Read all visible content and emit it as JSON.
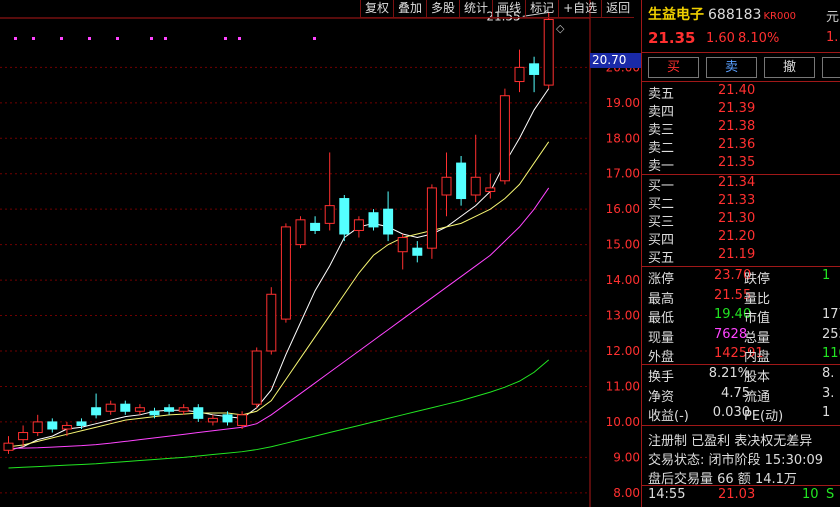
{
  "toolbar": [
    "复权",
    "叠加",
    "多股",
    "统计",
    "画线",
    "标记",
    "+自选",
    "返回"
  ],
  "colors": {
    "up": "#ff3030",
    "down": "#54ffff",
    "ma1": "#ffffff",
    "ma2": "#f6f673",
    "ma3": "#ff44ff",
    "ma4": "#22e622",
    "axis": "#b01818",
    "grid": "#700000",
    "sidebar_label": "#dddddd"
  },
  "chart_data": {
    "type": "candlestick",
    "ylim": [
      7.6,
      21.9
    ],
    "yticks": [
      "8.00",
      "9.00",
      "10.00",
      "11.00",
      "12.00",
      "13.00",
      "14.00",
      "15.00",
      "16.00",
      "17.00",
      "18.00",
      "19.00",
      "20.00"
    ],
    "current_price_label": "20.70",
    "high_annotation": "21.55",
    "candles": [
      {
        "o": 9.2,
        "c": 9.4,
        "h": 9.6,
        "l": 9.1
      },
      {
        "o": 9.5,
        "c": 9.7,
        "h": 9.9,
        "l": 9.3
      },
      {
        "o": 9.7,
        "c": 10.0,
        "h": 10.2,
        "l": 9.6
      },
      {
        "o": 10.0,
        "c": 9.8,
        "h": 10.1,
        "l": 9.7
      },
      {
        "o": 9.8,
        "c": 9.9,
        "h": 10.0,
        "l": 9.6
      },
      {
        "o": 10.0,
        "c": 9.9,
        "h": 10.1,
        "l": 9.8
      },
      {
        "o": 10.4,
        "c": 10.2,
        "h": 10.8,
        "l": 10.1
      },
      {
        "o": 10.3,
        "c": 10.5,
        "h": 10.6,
        "l": 10.2
      },
      {
        "o": 10.5,
        "c": 10.3,
        "h": 10.6,
        "l": 10.2
      },
      {
        "o": 10.3,
        "c": 10.4,
        "h": 10.5,
        "l": 10.2
      },
      {
        "o": 10.3,
        "c": 10.2,
        "h": 10.4,
        "l": 10.1
      },
      {
        "o": 10.4,
        "c": 10.3,
        "h": 10.5,
        "l": 10.2
      },
      {
        "o": 10.3,
        "c": 10.4,
        "h": 10.5,
        "l": 10.2
      },
      {
        "o": 10.4,
        "c": 10.1,
        "h": 10.5,
        "l": 10.0
      },
      {
        "o": 10.0,
        "c": 10.1,
        "h": 10.2,
        "l": 9.9
      },
      {
        "o": 10.2,
        "c": 10.0,
        "h": 10.3,
        "l": 9.9
      },
      {
        "o": 9.9,
        "c": 10.2,
        "h": 10.3,
        "l": 9.8
      },
      {
        "o": 10.5,
        "c": 12.0,
        "h": 12.1,
        "l": 10.4
      },
      {
        "o": 12.0,
        "c": 13.6,
        "h": 13.8,
        "l": 11.9
      },
      {
        "o": 12.9,
        "c": 15.5,
        "h": 15.6,
        "l": 12.8
      },
      {
        "o": 15.0,
        "c": 15.7,
        "h": 15.8,
        "l": 14.9
      },
      {
        "o": 15.6,
        "c": 15.4,
        "h": 15.8,
        "l": 15.3
      },
      {
        "o": 15.6,
        "c": 16.1,
        "h": 17.6,
        "l": 15.4
      },
      {
        "o": 16.3,
        "c": 15.3,
        "h": 16.4,
        "l": 15.1
      },
      {
        "o": 15.4,
        "c": 15.7,
        "h": 15.8,
        "l": 15.2
      },
      {
        "o": 15.9,
        "c": 15.5,
        "h": 16.0,
        "l": 15.4
      },
      {
        "o": 16.0,
        "c": 15.3,
        "h": 16.5,
        "l": 15.1
      },
      {
        "o": 14.8,
        "c": 15.2,
        "h": 15.3,
        "l": 14.3
      },
      {
        "o": 14.9,
        "c": 14.7,
        "h": 15.1,
        "l": 14.5
      },
      {
        "o": 14.9,
        "c": 16.6,
        "h": 16.7,
        "l": 14.6
      },
      {
        "o": 16.4,
        "c": 16.9,
        "h": 17.6,
        "l": 15.8
      },
      {
        "o": 17.3,
        "c": 16.3,
        "h": 17.5,
        "l": 16.1
      },
      {
        "o": 16.4,
        "c": 16.9,
        "h": 18.1,
        "l": 16.2
      },
      {
        "o": 16.5,
        "c": 16.6,
        "h": 17.0,
        "l": 16.3
      },
      {
        "o": 16.8,
        "c": 19.2,
        "h": 19.4,
        "l": 16.7
      },
      {
        "o": 19.6,
        "c": 20.0,
        "h": 20.5,
        "l": 19.3
      },
      {
        "o": 20.1,
        "c": 19.8,
        "h": 20.3,
        "l": 19.3
      },
      {
        "o": 19.5,
        "c": 21.35,
        "h": 21.55,
        "l": 19.4
      }
    ],
    "ma_lines": [
      {
        "name": "MA5",
        "color": "#ffffff",
        "values": [
          9.2,
          9.3,
          9.5,
          9.6,
          9.8,
          9.85,
          9.95,
          10.05,
          10.15,
          10.2,
          10.3,
          10.33,
          10.33,
          10.28,
          10.2,
          10.15,
          10.1,
          10.4,
          10.9,
          11.9,
          12.8,
          13.7,
          14.4,
          15.2,
          15.5,
          15.6,
          15.5,
          15.3,
          15.2,
          15.3,
          15.5,
          15.8,
          16.1,
          16.5,
          17.3,
          18.0,
          18.8,
          19.4
        ]
      },
      {
        "name": "MA10",
        "color": "#f6f673",
        "values": [
          9.3,
          9.35,
          9.45,
          9.55,
          9.65,
          9.75,
          9.85,
          9.95,
          10.05,
          10.1,
          10.15,
          10.2,
          10.22,
          10.25,
          10.25,
          10.25,
          10.2,
          10.3,
          10.6,
          11.2,
          11.8,
          12.4,
          13.0,
          13.6,
          14.2,
          14.7,
          15.0,
          15.2,
          15.3,
          15.4,
          15.5,
          15.6,
          15.8,
          16.0,
          16.3,
          16.7,
          17.3,
          17.9
        ]
      },
      {
        "name": "MA20",
        "color": "#ff44ff",
        "values": [
          9.25,
          9.26,
          9.27,
          9.29,
          9.31,
          9.33,
          9.36,
          9.4,
          9.45,
          9.5,
          9.55,
          9.6,
          9.65,
          9.7,
          9.75,
          9.8,
          9.85,
          9.95,
          10.2,
          10.5,
          10.8,
          11.1,
          11.4,
          11.7,
          12.0,
          12.3,
          12.6,
          12.9,
          13.2,
          13.5,
          13.8,
          14.1,
          14.4,
          14.7,
          15.1,
          15.5,
          16.0,
          16.6
        ]
      },
      {
        "name": "MA60",
        "color": "#22e622",
        "values": [
          8.7,
          8.72,
          8.74,
          8.76,
          8.78,
          8.8,
          8.82,
          8.85,
          8.88,
          8.91,
          8.94,
          8.97,
          9.0,
          9.04,
          9.08,
          9.12,
          9.16,
          9.22,
          9.3,
          9.4,
          9.5,
          9.6,
          9.7,
          9.8,
          9.9,
          10.0,
          10.1,
          10.2,
          10.3,
          10.4,
          10.5,
          10.6,
          10.72,
          10.84,
          10.98,
          11.15,
          11.4,
          11.75
        ]
      }
    ],
    "markers_count": 10
  },
  "sidebar": {
    "name": "生益电子",
    "code": "688183",
    "tag": "KR000",
    "unit": "元",
    "price_top_right": "1.",
    "price": "21.35",
    "change": "1.60",
    "pct": "8.10%",
    "buttons": [
      "买",
      "卖",
      "撤",
      "买"
    ],
    "sells": [
      {
        "label": "卖五",
        "price": "21.40"
      },
      {
        "label": "卖四",
        "price": "21.39"
      },
      {
        "label": "卖三",
        "price": "21.38"
      },
      {
        "label": "卖二",
        "price": "21.36"
      },
      {
        "label": "卖一",
        "price": "21.35"
      }
    ],
    "buys": [
      {
        "label": "买一",
        "price": "21.34"
      },
      {
        "label": "买二",
        "price": "21.33"
      },
      {
        "label": "买三",
        "price": "21.30"
      },
      {
        "label": "买四",
        "price": "21.20"
      },
      {
        "label": "买五",
        "price": "21.19"
      }
    ],
    "stats1": [
      {
        "l1": "涨停",
        "v1": "23.70",
        "c1": "#ff3030",
        "l2": "跌停",
        "v2": "1",
        "c2": "#22e622"
      },
      {
        "l1": "最高",
        "v1": "21.55",
        "c1": "#ff3030",
        "l2": "量比",
        "v2": "",
        "c2": "#dddddd"
      },
      {
        "l1": "最低",
        "v1": "19.40",
        "c1": "#22e622",
        "l2": "市值",
        "v2": "177",
        "c2": "#dddddd"
      },
      {
        "l1": "现量",
        "v1": "7628",
        "c1": "#ff44ff",
        "l2": "总量",
        "v2": "253",
        "c2": "#dddddd"
      },
      {
        "l1": "外盘",
        "v1": "142591",
        "c1": "#ff3030",
        "l2": "内盘",
        "v2": "110",
        "c2": "#22e622"
      }
    ],
    "stats2": [
      {
        "l1": "换手",
        "v1": "8.21%",
        "l2": "股本",
        "v2": "8."
      },
      {
        "l1": "净资",
        "v1": "4.75",
        "l2": "流通",
        "v2": "3."
      },
      {
        "l1": "收益(-)",
        "v1": "0.030",
        "l2": "PE(动)",
        "v2": "1"
      }
    ],
    "info1": "注册制 已盈利 表决权无差异",
    "info2": "交易状态: 闭市阶段 15:30:09",
    "info3": "盘后交易量 66 额 14.1万",
    "tick": {
      "time": "14:55",
      "price": "21.03",
      "vol": "10",
      "side": "S"
    }
  }
}
